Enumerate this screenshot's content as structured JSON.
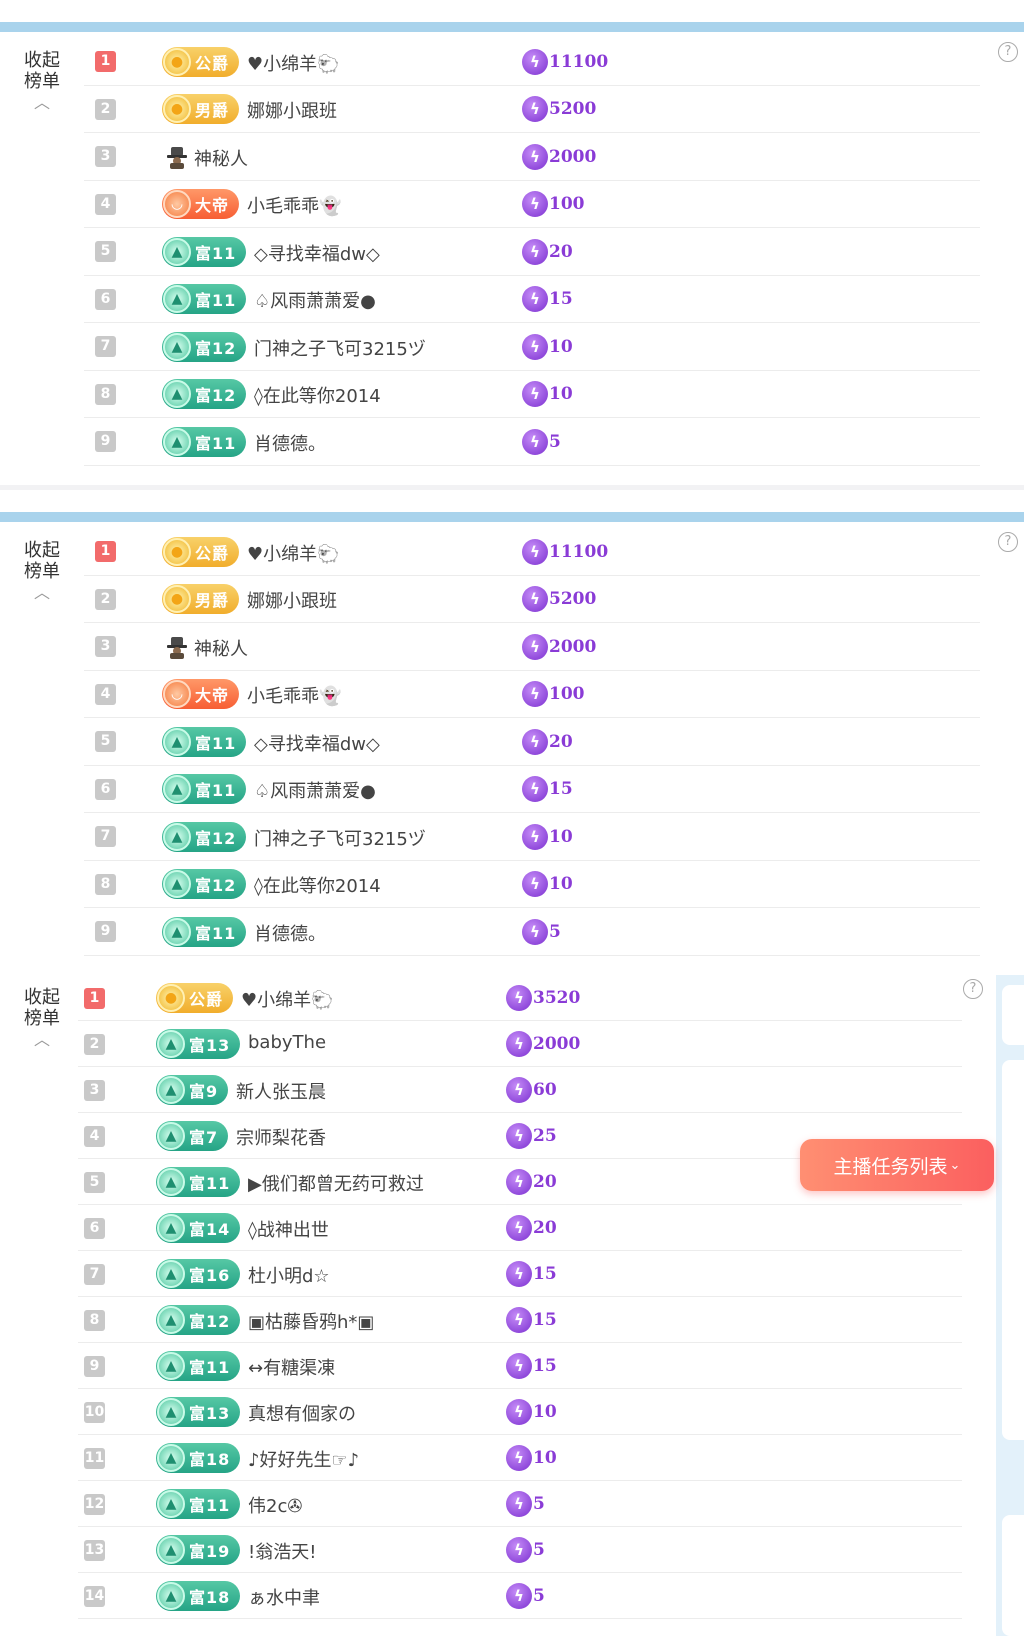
{
  "panels": [
    {
      "collapse_label": "收起榜单",
      "collapse_label_lines": [
        "收起",
        "榜单"
      ],
      "help_icon": "?",
      "rows": [
        {
          "rank": "1",
          "badge": {
            "type": "gold",
            "icon": "crown-gold",
            "text": "公爵"
          },
          "name": "♥小绵羊🐑",
          "amount": "11100"
        },
        {
          "rank": "2",
          "badge": {
            "type": "gold",
            "icon": "crown-gold",
            "text": "男爵"
          },
          "name": "娜娜小跟班",
          "amount": "5200"
        },
        {
          "rank": "3",
          "badge": {
            "type": "hat",
            "icon": "mystery-hat"
          },
          "name": "神秘人",
          "amount": "2000"
        },
        {
          "rank": "4",
          "badge": {
            "type": "orange",
            "icon": "emperor",
            "text": "大帝"
          },
          "name": "小毛乖乖👻",
          "amount": "100"
        },
        {
          "rank": "5",
          "badge": {
            "type": "green",
            "icon": "rich-level",
            "text": "富11"
          },
          "name": "◇寻找幸福dw◇",
          "amount": "20"
        },
        {
          "rank": "6",
          "badge": {
            "type": "green",
            "icon": "rich-level",
            "text": "富11"
          },
          "name": "♤风雨萧萧爱●",
          "amount": "15"
        },
        {
          "rank": "7",
          "badge": {
            "type": "green",
            "icon": "rich-level",
            "text": "富12"
          },
          "name": "门神之子飞可3215ヅ",
          "amount": "10"
        },
        {
          "rank": "8",
          "badge": {
            "type": "green",
            "icon": "rich-level",
            "text": "富12"
          },
          "name": "◊在此等你2014",
          "amount": "10"
        },
        {
          "rank": "9",
          "badge": {
            "type": "green",
            "icon": "rich-level",
            "text": "富11"
          },
          "name": "肖德德。",
          "amount": "5"
        }
      ]
    },
    {
      "collapse_label": "收起榜单",
      "collapse_label_lines": [
        "收起",
        "榜单"
      ],
      "help_icon": "?",
      "rows": [
        {
          "rank": "1",
          "badge": {
            "type": "gold",
            "icon": "crown-gold",
            "text": "公爵"
          },
          "name": "♥小绵羊🐑",
          "amount": "11100"
        },
        {
          "rank": "2",
          "badge": {
            "type": "gold",
            "icon": "crown-gold",
            "text": "男爵"
          },
          "name": "娜娜小跟班",
          "amount": "5200"
        },
        {
          "rank": "3",
          "badge": {
            "type": "hat",
            "icon": "mystery-hat"
          },
          "name": "神秘人",
          "amount": "2000"
        },
        {
          "rank": "4",
          "badge": {
            "type": "orange",
            "icon": "emperor",
            "text": "大帝"
          },
          "name": "小毛乖乖👻",
          "amount": "100"
        },
        {
          "rank": "5",
          "badge": {
            "type": "green",
            "icon": "rich-level",
            "text": "富11"
          },
          "name": "◇寻找幸福dw◇",
          "amount": "20"
        },
        {
          "rank": "6",
          "badge": {
            "type": "green",
            "icon": "rich-level",
            "text": "富11"
          },
          "name": "♤风雨萧萧爱●",
          "amount": "15"
        },
        {
          "rank": "7",
          "badge": {
            "type": "green",
            "icon": "rich-level",
            "text": "富12"
          },
          "name": "门神之子飞可3215ヅ",
          "amount": "10"
        },
        {
          "rank": "8",
          "badge": {
            "type": "green",
            "icon": "rich-level",
            "text": "富12"
          },
          "name": "◊在此等你2014",
          "amount": "10"
        },
        {
          "rank": "9",
          "badge": {
            "type": "green",
            "icon": "rich-level",
            "text": "富11"
          },
          "name": "肖德德。",
          "amount": "5"
        }
      ]
    },
    {
      "collapse_label": "收起榜单",
      "collapse_label_lines": [
        "收起",
        "榜单"
      ],
      "help_icon": "?",
      "rows": [
        {
          "rank": "1",
          "badge": {
            "type": "gold",
            "icon": "crown-gold",
            "text": "公爵"
          },
          "name": "♥小绵羊🐑",
          "amount": "3520"
        },
        {
          "rank": "2",
          "badge": {
            "type": "green",
            "icon": "rich-level",
            "text": "富13"
          },
          "name": "babyThe",
          "amount": "2000"
        },
        {
          "rank": "3",
          "badge": {
            "type": "green",
            "icon": "rich-level",
            "text": "富9"
          },
          "name": "新人张玉晨",
          "amount": "60"
        },
        {
          "rank": "4",
          "badge": {
            "type": "green",
            "icon": "rich-level",
            "text": "富7"
          },
          "name": "宗师梨花香",
          "amount": "25"
        },
        {
          "rank": "5",
          "badge": {
            "type": "green",
            "icon": "rich-level",
            "text": "富11"
          },
          "name": "▶俄们都曾无药可救过",
          "amount": "20"
        },
        {
          "rank": "6",
          "badge": {
            "type": "green",
            "icon": "rich-level",
            "text": "富14"
          },
          "name": "◊战神出世",
          "amount": "20"
        },
        {
          "rank": "7",
          "badge": {
            "type": "green",
            "icon": "rich-level",
            "text": "富16"
          },
          "name": "杜小明d☆",
          "amount": "15"
        },
        {
          "rank": "8",
          "badge": {
            "type": "green",
            "icon": "rich-level",
            "text": "富12"
          },
          "name": "▣枯藤昏鸦h*▣",
          "amount": "15"
        },
        {
          "rank": "9",
          "badge": {
            "type": "green",
            "icon": "rich-level",
            "text": "富11"
          },
          "name": "↔有糖渠凍",
          "amount": "15"
        },
        {
          "rank": "10",
          "badge": {
            "type": "green",
            "icon": "rich-level",
            "text": "富13"
          },
          "name": "真想有個家の",
          "amount": "10"
        },
        {
          "rank": "11",
          "badge": {
            "type": "green",
            "icon": "rich-level",
            "text": "富18"
          },
          "name": "♪好好先生☞♪",
          "amount": "10"
        },
        {
          "rank": "12",
          "badge": {
            "type": "green",
            "icon": "rich-level",
            "text": "富11"
          },
          "name": "伟2c✇",
          "amount": "5"
        },
        {
          "rank": "13",
          "badge": {
            "type": "green",
            "icon": "rich-level",
            "text": "富19"
          },
          "name": "!翁浩天!",
          "amount": "5"
        },
        {
          "rank": "14",
          "badge": {
            "type": "green",
            "icon": "rich-level",
            "text": "富18"
          },
          "name": "ぁ水中聿",
          "amount": "5"
        }
      ]
    }
  ],
  "task_button": "主播任务列表",
  "colors": {
    "accent_bar": "#a9d3ec",
    "rank_first": "#f26b6b",
    "rank_other": "#c9c9c9",
    "gold_badge": "#f1ad2c",
    "orange_badge": "#f75e34",
    "green_badge": "#25a486",
    "amount_purple": "#8a3bd6",
    "task_button": "#fb5f5f"
  }
}
